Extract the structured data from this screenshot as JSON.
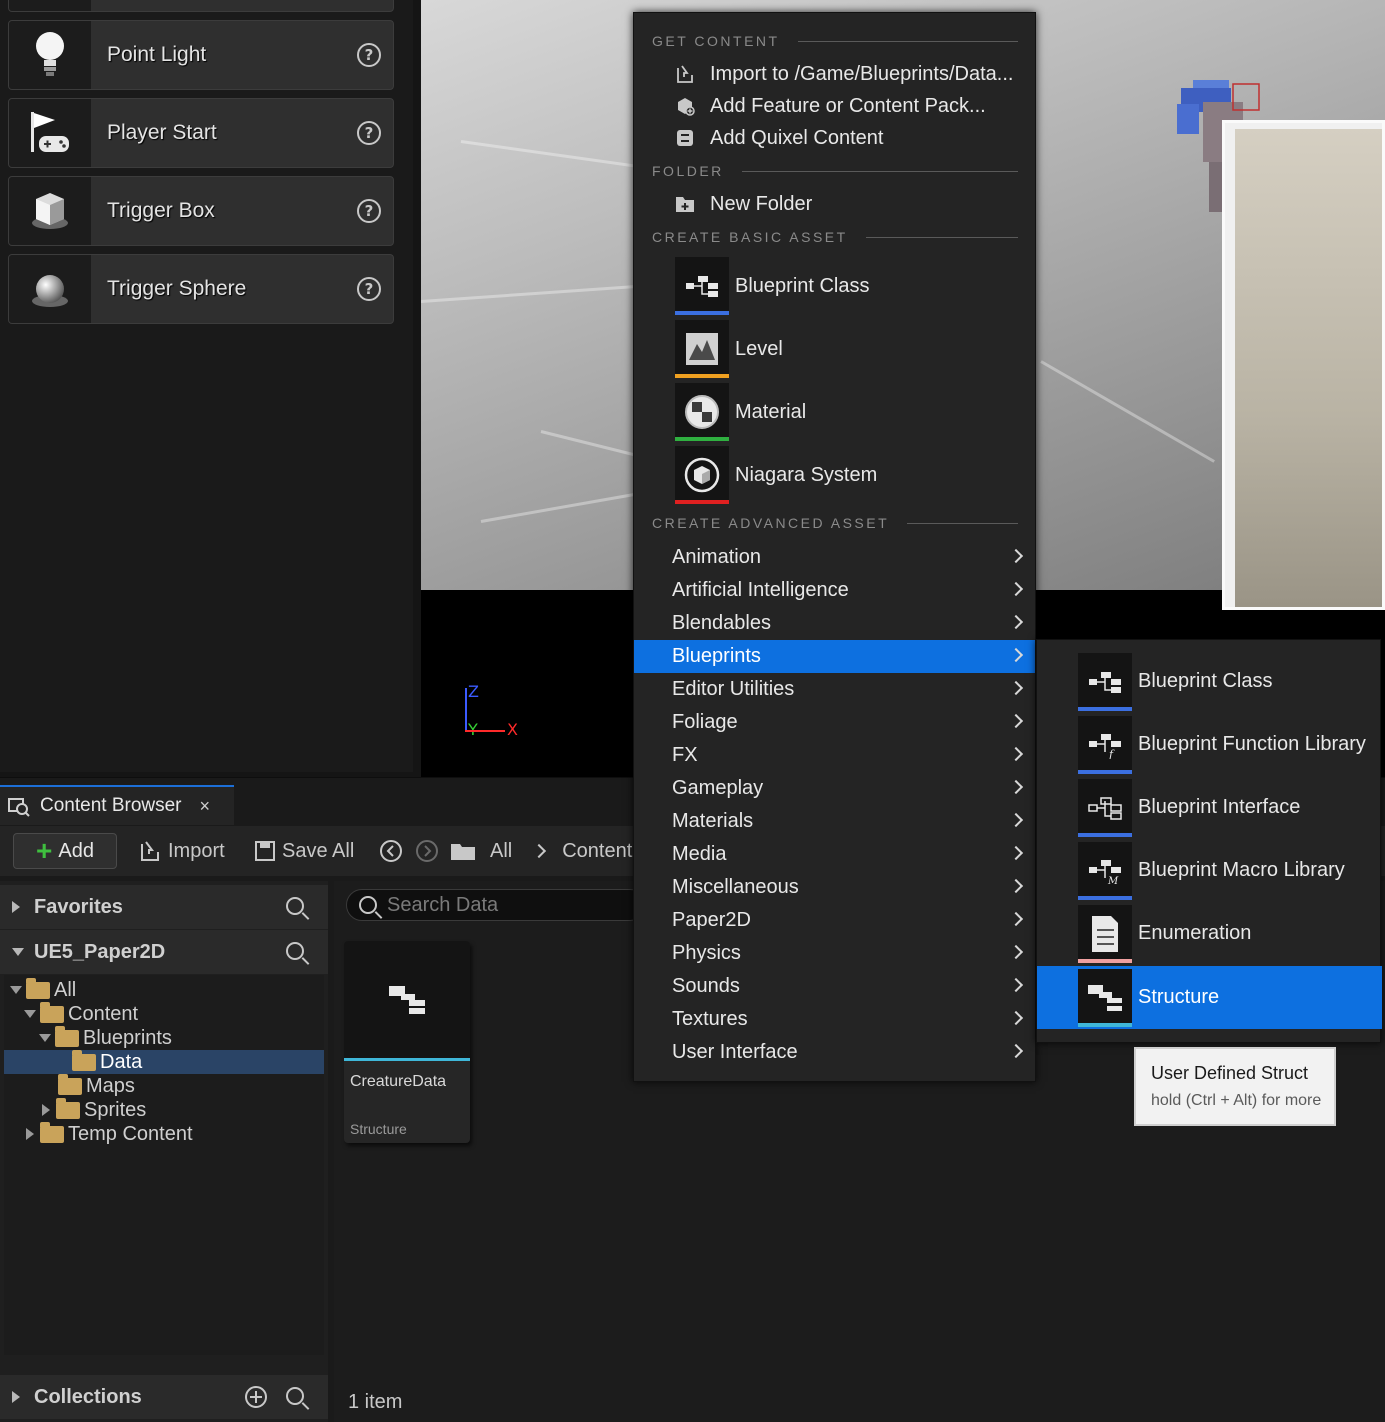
{
  "place_actors": {
    "items": [
      {
        "label": "Point Light",
        "icon": "light-bulb-icon"
      },
      {
        "label": "Player Start",
        "icon": "player-start-icon"
      },
      {
        "label": "Trigger Box",
        "icon": "trigger-box-icon"
      },
      {
        "label": "Trigger Sphere",
        "icon": "trigger-sphere-icon"
      }
    ],
    "help_glyph": "?"
  },
  "viewport": {
    "axis": {
      "z": "Z",
      "y": "Y",
      "x": "X"
    },
    "axis_colors": {
      "z": "#3b5bff",
      "y": "#35d035",
      "x": "#ff2a2a"
    }
  },
  "content_browser": {
    "tab_label": "Content Browser",
    "tab_close": "×",
    "toolbar": {
      "add_label": "Add",
      "import_label": "Import",
      "save_all_label": "Save All",
      "breadcrumb": [
        "All",
        "Content"
      ]
    },
    "favorites_label": "Favorites",
    "project_label": "UE5_Paper2D",
    "tree": [
      {
        "label": "All",
        "depth": 0,
        "expanded": true
      },
      {
        "label": "Content",
        "depth": 1,
        "expanded": true
      },
      {
        "label": "Blueprints",
        "depth": 2,
        "expanded": true
      },
      {
        "label": "Data",
        "depth": 3,
        "selected": true
      },
      {
        "label": "Maps",
        "depth": 3
      },
      {
        "label": "Sprites",
        "depth": 2,
        "expanded": false
      },
      {
        "label": "Temp Content",
        "depth": 1,
        "expanded": false
      }
    ],
    "collections_label": "Collections",
    "search_placeholder": "Search Data",
    "asset": {
      "name": "CreatureData",
      "type": "Structure"
    },
    "item_count": "1 item"
  },
  "context_menu": {
    "sections": {
      "get_content": "GET CONTENT",
      "folder": "FOLDER",
      "create_basic": "CREATE BASIC ASSET",
      "create_advanced": "CREATE ADVANCED ASSET"
    },
    "get_content_items": [
      {
        "label": "Import to /Game/Blueprints/Data...",
        "icon": "import-icon"
      },
      {
        "label": "Add Feature or Content Pack...",
        "icon": "feature-pack-icon"
      },
      {
        "label": "Add Quixel Content",
        "icon": "quixel-icon"
      }
    ],
    "folder_items": [
      {
        "label": "New Folder",
        "icon": "new-folder-icon"
      }
    ],
    "basic_assets": [
      {
        "label": "Blueprint Class",
        "icon": "blueprint-class-icon",
        "color": "#3b6fe0"
      },
      {
        "label": "Level",
        "icon": "level-icon",
        "color": "#f0a020"
      },
      {
        "label": "Material",
        "icon": "material-icon",
        "color": "#2fb040"
      },
      {
        "label": "Niagara System",
        "icon": "niagara-icon",
        "color": "#e02020"
      }
    ],
    "advanced_categories": [
      "Animation",
      "Artificial Intelligence",
      "Blendables",
      "Blueprints",
      "Editor Utilities",
      "Foliage",
      "FX",
      "Gameplay",
      "Materials",
      "Media",
      "Miscellaneous",
      "Paper2D",
      "Physics",
      "Sounds",
      "Textures",
      "User Interface"
    ],
    "highlighted_category": "Blueprints",
    "highlight_color": "#0d70e0"
  },
  "submenu": {
    "items": [
      {
        "label": "Blueprint Class",
        "icon": "blueprint-class-icon",
        "color": "#3b6fe0"
      },
      {
        "label": "Blueprint Function Library",
        "icon": "blueprint-function-library-icon",
        "color": "#3b6fe0"
      },
      {
        "label": "Blueprint Interface",
        "icon": "blueprint-interface-icon",
        "color": "#3b6fe0"
      },
      {
        "label": "Blueprint Macro Library",
        "icon": "blueprint-macro-library-icon",
        "color": "#3b6fe0"
      },
      {
        "label": "Enumeration",
        "icon": "enumeration-icon",
        "color": "#f0a0a0"
      },
      {
        "label": "Structure",
        "icon": "structure-icon",
        "color": "#3fb7d8"
      }
    ],
    "highlighted": "Structure",
    "macro_letter": "M",
    "function_letter": "f"
  },
  "tooltip": {
    "title": "User Defined Struct",
    "hint": "hold (Ctrl + Alt) for more"
  }
}
